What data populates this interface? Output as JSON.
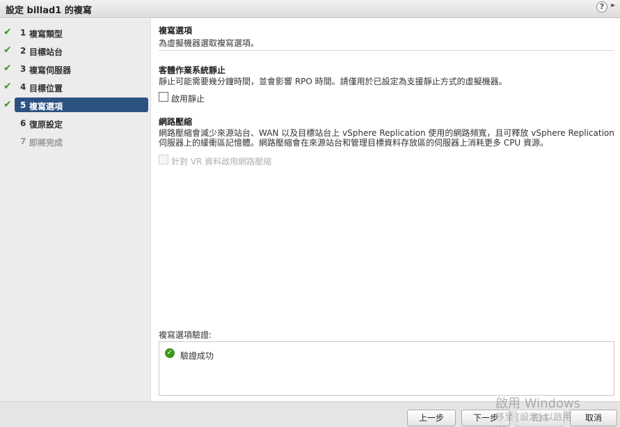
{
  "window": {
    "title": "設定 billad1 的複寫",
    "help_glyph": "?",
    "expand_glyph": "▸▸"
  },
  "steps": [
    {
      "num": "1",
      "label": "複寫類型",
      "state": "done"
    },
    {
      "num": "2",
      "label": "目標站台",
      "state": "done"
    },
    {
      "num": "3",
      "label": "複寫伺服器",
      "state": "done"
    },
    {
      "num": "4",
      "label": "目標位置",
      "state": "done"
    },
    {
      "num": "5",
      "label": "複寫選項",
      "state": "active"
    },
    {
      "num": "6",
      "label": "復原設定",
      "state": "pending"
    },
    {
      "num": "7",
      "label": "即將完成",
      "state": "disabled"
    }
  ],
  "header": {
    "title": "複寫選項",
    "subtitle": "為虛擬機器選取複寫選項。"
  },
  "quiesce": {
    "title": "客體作業系統靜止",
    "desc": "靜止可能需要幾分鐘時間，並會影響 RPO 時間。請僅用於已設定為支援靜止方式的虛擬機器。",
    "checkbox_label": "啟用靜止",
    "checked": false
  },
  "compression": {
    "title": "網路壓縮",
    "desc": "網路壓縮會減少來源站台、WAN 以及目標站台上 vSphere Replication 使用的網路頻寬，且可釋放 vSphere Replication 伺服器上的緩衝區記憶體。網路壓縮會在來源站台和管理目標資料存放區的伺服器上消耗更多 CPU 資源。",
    "checkbox_label": "針對 VR 資料啟用網路壓縮",
    "checked": false,
    "enabled": false
  },
  "validation": {
    "title": "複寫選項驗證:",
    "result": "驗證成功"
  },
  "footer": {
    "back_label": "上一步",
    "next_label": "下一步",
    "finish_label": "完成",
    "cancel_label": "取消"
  },
  "watermark": {
    "line1": "啟用 Windows",
    "line2": "移至 [設定] 以啟用 Windows。"
  },
  "colors": {
    "active_step_bg": "#2c5282",
    "check_green": "#3a9a1e"
  },
  "icons": {
    "step_done": "check-icon",
    "validation_ok": "success-icon"
  }
}
